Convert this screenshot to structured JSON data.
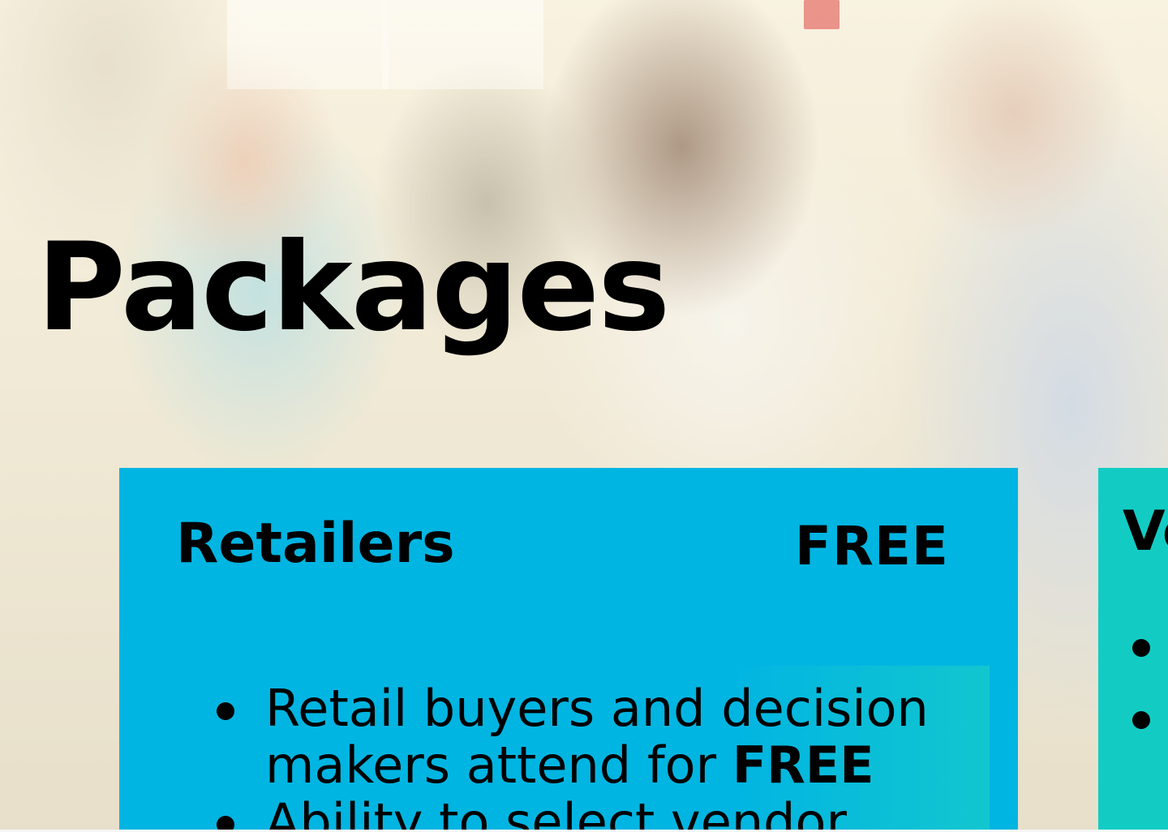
{
  "hero": {
    "title": "Packages"
  },
  "cards": {
    "retailers": {
      "title": "Retailers",
      "price": "FREE",
      "features": [
        {
          "text": "Retail buyers and decision makers attend for ",
          "emphasis": "FREE"
        },
        {
          "text": "Ability to select vendor"
        }
      ]
    },
    "vendors": {
      "title": "Ve"
    }
  },
  "colors": {
    "retailers_card": "#01b5e2",
    "vendors_card": "#12ccc4",
    "text": "#000000"
  }
}
